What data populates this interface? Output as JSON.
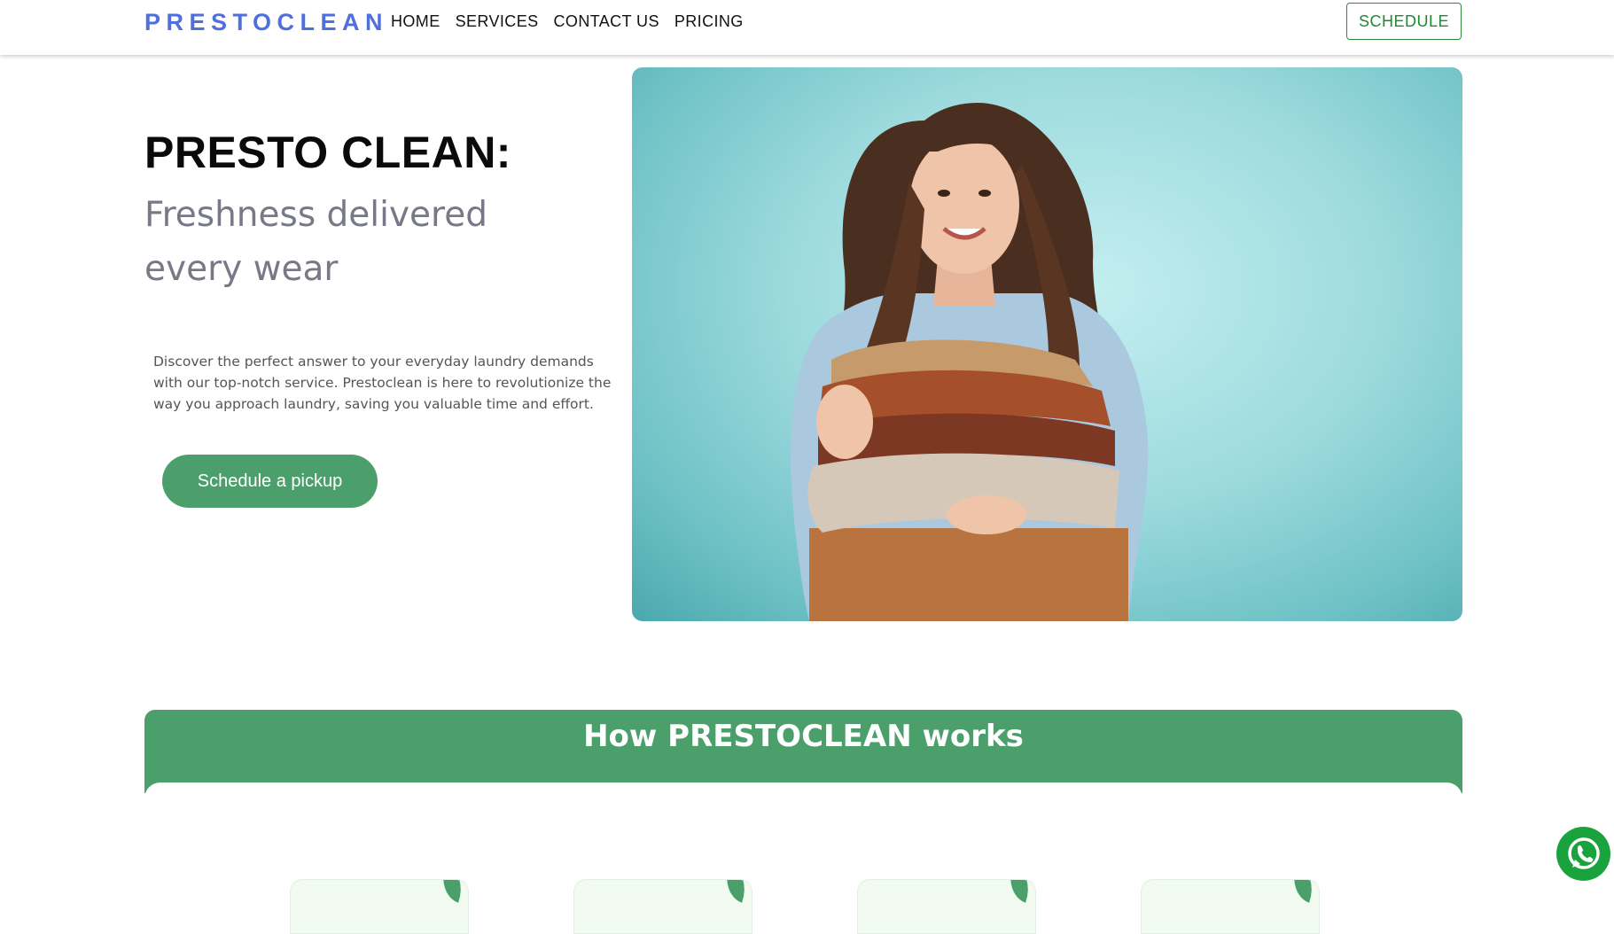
{
  "nav": {
    "brand": "PRESTOCLEAN",
    "links": [
      "HOME",
      "SERVICES",
      "CONTACT US",
      "PRICING"
    ],
    "schedule_label": "SCHEDULE"
  },
  "hero": {
    "title": "PRESTO CLEAN:",
    "subtitle": "Freshness delivered every wear",
    "description": "Discover the perfect answer to your everyday laundry demands with our top-notch service. Prestoclean is here to revolutionize the way you approach laundry, saving you valuable time and effort.",
    "cta_label": "Schedule a pickup"
  },
  "works": {
    "title": "How PRESTOCLEAN works"
  },
  "colors": {
    "brand": "#4f6fdc",
    "accent_green": "#4a9f6b",
    "schedule_border": "#2a8a3a",
    "whatsapp": "#1aa33c"
  },
  "icons": {
    "whatsapp": "whatsapp-icon"
  }
}
